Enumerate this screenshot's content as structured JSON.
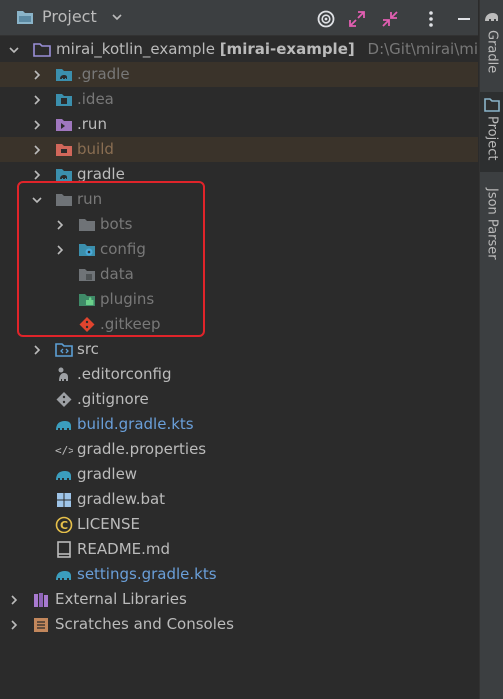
{
  "header": {
    "title": "Project"
  },
  "root": {
    "name": "mirai_kotlin_example",
    "module": "[mirai-example]",
    "path": "D:\\Git\\mirai\\mirai_k"
  },
  "tree": [
    {
      "label": ".gradle",
      "depth": 1,
      "arrow": "right",
      "icon": "gradle-folder",
      "color": "dim",
      "hl": true
    },
    {
      "label": ".idea",
      "depth": 1,
      "arrow": "right",
      "icon": "idea-folder",
      "color": "dim",
      "hl": false
    },
    {
      "label": ".run",
      "depth": 1,
      "arrow": "right",
      "icon": "run-folder",
      "color": "norm",
      "hl": false
    },
    {
      "label": "build",
      "depth": 1,
      "arrow": "right",
      "icon": "build-folder",
      "color": "brown",
      "hl": true
    },
    {
      "label": "gradle",
      "depth": 1,
      "arrow": "right",
      "icon": "gradle-folder",
      "color": "norm",
      "hl": false
    },
    {
      "label": "run",
      "depth": 1,
      "arrow": "down",
      "icon": "folder",
      "color": "dim",
      "hl": false
    },
    {
      "label": "bots",
      "depth": 2,
      "arrow": "right",
      "icon": "folder",
      "color": "dim",
      "hl": false
    },
    {
      "label": "config",
      "depth": 2,
      "arrow": "right",
      "icon": "config-folder",
      "color": "dim",
      "hl": false
    },
    {
      "label": "data",
      "depth": 2,
      "arrow": "none",
      "icon": "data-folder",
      "color": "dim",
      "hl": false
    },
    {
      "label": "plugins",
      "depth": 2,
      "arrow": "none",
      "icon": "plugins-folder",
      "color": "dim",
      "hl": false
    },
    {
      "label": ".gitkeep",
      "depth": 2,
      "arrow": "none",
      "icon": "git-file",
      "color": "dim",
      "hl": false
    },
    {
      "label": "src",
      "depth": 1,
      "arrow": "right",
      "icon": "src-folder",
      "color": "norm",
      "hl": false
    },
    {
      "label": ".editorconfig",
      "depth": 1,
      "arrow": "none",
      "icon": "editorconfig-file",
      "color": "norm",
      "hl": false
    },
    {
      "label": ".gitignore",
      "depth": 1,
      "arrow": "none",
      "icon": "gitignore-file",
      "color": "norm",
      "hl": false
    },
    {
      "label": "build.gradle.kts",
      "depth": 1,
      "arrow": "none",
      "icon": "gradle-file",
      "color": "blue",
      "hl": false
    },
    {
      "label": "gradle.properties",
      "depth": 1,
      "arrow": "none",
      "icon": "properties-file",
      "color": "norm",
      "hl": false
    },
    {
      "label": "gradlew",
      "depth": 1,
      "arrow": "none",
      "icon": "gradle-file",
      "color": "norm",
      "hl": false
    },
    {
      "label": "gradlew.bat",
      "depth": 1,
      "arrow": "none",
      "icon": "windows-file",
      "color": "norm",
      "hl": false
    },
    {
      "label": "LICENSE",
      "depth": 1,
      "arrow": "none",
      "icon": "license-file",
      "color": "norm",
      "hl": false
    },
    {
      "label": "README.md",
      "depth": 1,
      "arrow": "none",
      "icon": "markdown-file",
      "color": "norm",
      "hl": false
    },
    {
      "label": "settings.gradle.kts",
      "depth": 1,
      "arrow": "none",
      "icon": "gradle-file",
      "color": "blue",
      "hl": false
    },
    {
      "label": "External Libraries",
      "depth": 0,
      "arrow": "right",
      "icon": "libraries",
      "color": "norm",
      "hl": false
    },
    {
      "label": "Scratches and Consoles",
      "depth": 0,
      "arrow": "right",
      "icon": "scratches",
      "color": "norm",
      "hl": false
    }
  ],
  "side_tabs": [
    {
      "label": "Gradle",
      "active": false
    },
    {
      "label": "Project",
      "active": true
    },
    {
      "label": "Json Parser",
      "active": false
    }
  ]
}
